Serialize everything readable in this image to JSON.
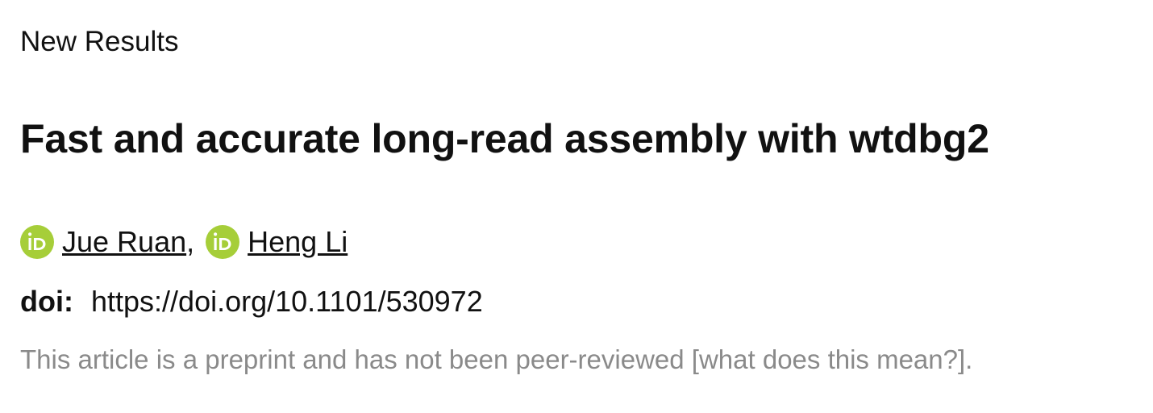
{
  "article": {
    "section_label": "New Results",
    "title": "Fast and accurate long-read assembly with wtdbg2",
    "authors": [
      {
        "name": "Jue Ruan",
        "separator": ",",
        "icon": "orcid-icon"
      },
      {
        "name": "Heng Li",
        "separator": "",
        "icon": "orcid-icon"
      }
    ],
    "doi_label": "doi:",
    "doi_url": "https://doi.org/10.1101/530972",
    "notice_text": "This article is a preprint and has not been peer-reviewed ",
    "notice_link": "[what does this mean?]",
    "notice_end": "."
  },
  "colors": {
    "orcid_green": "#A6CE39",
    "text": "#111111",
    "muted": "#8a8a8a"
  }
}
